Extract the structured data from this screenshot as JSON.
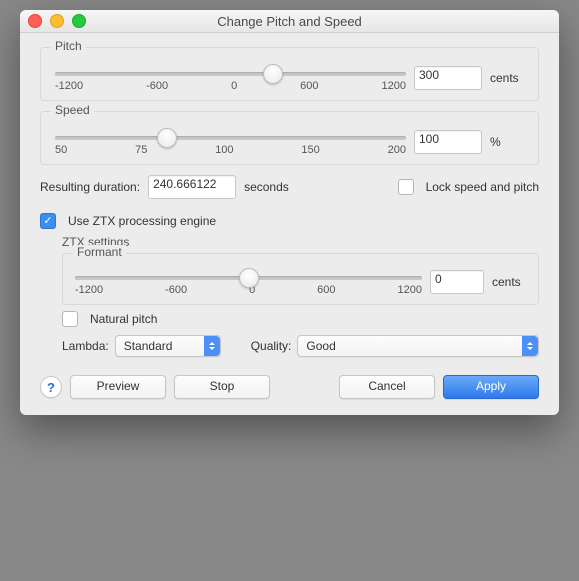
{
  "window": {
    "title": "Change Pitch and Speed"
  },
  "pitch": {
    "label": "Pitch",
    "value": "300",
    "unit": "cents",
    "ticks": [
      "-1200",
      "-600",
      "0",
      "600",
      "1200"
    ],
    "thumb_pct": 62
  },
  "speed": {
    "label": "Speed",
    "value": "100",
    "unit": "%",
    "ticks": [
      "50",
      "75",
      "100",
      "150",
      "200"
    ],
    "thumb_pct": 32
  },
  "duration": {
    "label": "Resulting duration:",
    "value": "240.666122",
    "unit": "seconds"
  },
  "lock": {
    "label": "Lock speed and pitch",
    "checked": false
  },
  "ztx": {
    "use_label": "Use ZTX processing engine",
    "settings_label": "ZTX settings",
    "formant": {
      "label": "Formant",
      "value": "0",
      "unit": "cents",
      "ticks": [
        "-1200",
        "-600",
        "0",
        "600",
        "1200"
      ],
      "thumb_pct": 50
    },
    "natural_pitch_label": "Natural pitch",
    "lambda_label": "Lambda:",
    "lambda_value": "Standard",
    "quality_label": "Quality:",
    "quality_value": "Good"
  },
  "buttons": {
    "preview": "Preview",
    "stop": "Stop",
    "cancel": "Cancel",
    "apply": "Apply"
  }
}
